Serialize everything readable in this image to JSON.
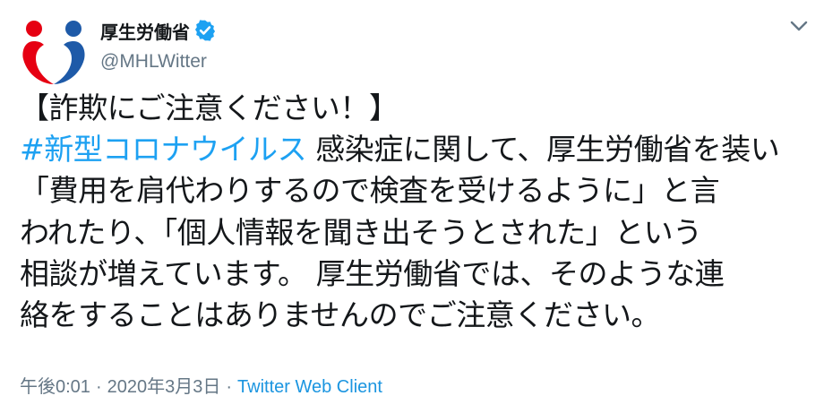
{
  "account": {
    "display_name": "厚生労働省",
    "handle": "@MHLWitter",
    "verified": true
  },
  "tweet": {
    "lines": [
      {
        "text": "【詐欺にご注意ください！】"
      },
      {
        "hashtag": "#新型コロナウイルス",
        "text": " 感染症に関して、厚生労働省を装い"
      },
      {
        "text": "「費用を肩代わりするので検査を受けるように」と言"
      },
      {
        "text": "われたり、「個人情報を聞き出そうとされた」という"
      },
      {
        "text": "相談が増えています。 厚生労働省では、そのような連"
      },
      {
        "text": "絡をすることはありませんのでご注意ください。"
      }
    ]
  },
  "meta": {
    "time": "午後0:01",
    "separator": "·",
    "date": "2020年3月3日",
    "client": "Twitter Web Client"
  },
  "colors": {
    "text": "#14171a",
    "secondary": "#657786",
    "link": "#1da1f2",
    "verified": "#1da1f2",
    "logo_red": "#e60012",
    "logo_blue": "#1e5aa8"
  },
  "icons": [
    "mhlw-logo-icon",
    "verified-badge-icon",
    "chevron-down-icon"
  ]
}
